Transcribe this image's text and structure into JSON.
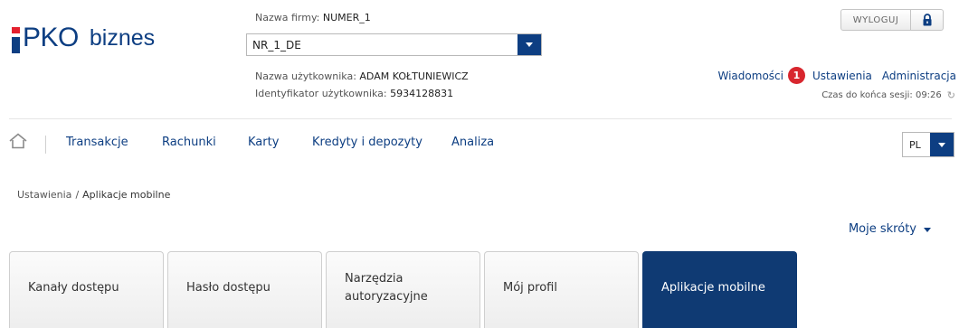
{
  "brand": {
    "logo_main": "PKO",
    "logo_sub": "biznes"
  },
  "company": {
    "label": "Nazwa firmy:",
    "name": "NUMER_1",
    "selected": "NR_1_DE"
  },
  "user": {
    "name_label": "Nazwa użytkownika:",
    "name": "ADAM KOŁTUNIEWICZ",
    "id_label": "Identyfikator użytkownika:",
    "id": "5934128831"
  },
  "header": {
    "logout_label": "WYLOGUJ",
    "messages_label": "Wiadomości",
    "messages_count": "1",
    "settings_label": "Ustawienia",
    "admin_label": "Administracja",
    "session_text": "Czas do końca sesji: 09:26"
  },
  "nav": {
    "items": [
      {
        "label": "Transakcje"
      },
      {
        "label": "Rachunki"
      },
      {
        "label": "Karty"
      },
      {
        "label": "Kredyty i depozyty"
      },
      {
        "label": "Analiza"
      }
    ],
    "language": "PL"
  },
  "breadcrumb": {
    "parent": "Ustawienia",
    "separator": "/",
    "current": "Aplikacje mobilne"
  },
  "shortcuts_label": "Moje skróty",
  "tabs": [
    {
      "label": "Kanały dostępu",
      "active": false
    },
    {
      "label": "Hasło dostępu",
      "active": false
    },
    {
      "label": "Narzędzia autoryzacyjne",
      "active": false
    },
    {
      "label": "Mój profil",
      "active": false
    },
    {
      "label": "Aplikacje mobilne",
      "active": true
    }
  ],
  "colors": {
    "brand_blue": "#0d3e82",
    "brand_red": "#e4202e",
    "badge_red": "#d8262e",
    "active_tab": "#0f3a73"
  },
  "icons": {
    "home": "home-icon",
    "lock": "lock-icon",
    "refresh": "refresh-icon",
    "caret": "caret-down-icon"
  }
}
